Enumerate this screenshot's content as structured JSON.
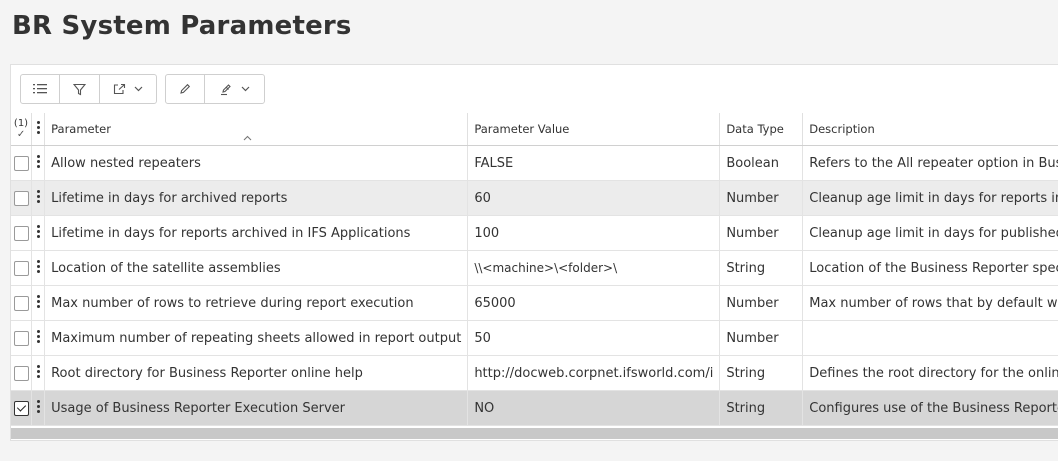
{
  "page": {
    "title": "BR System Parameters"
  },
  "toolbar": {
    "icons": [
      "column-list-icon",
      "filter-icon",
      "export-icon",
      "chevron-down-icon",
      "edit-pencil-icon",
      "bulk-edit-icon",
      "chevron-down-icon"
    ]
  },
  "table": {
    "selected_count": "(1)",
    "selected_count_mark": "✓",
    "columns": {
      "parameter": "Parameter",
      "value": "Parameter Value",
      "type": "Data Type",
      "description": "Description"
    },
    "sorted_column": "parameter",
    "sort_direction": "ascending",
    "rows": [
      {
        "parameter": "Allow nested repeaters",
        "value": "FALSE",
        "type": "Boolean",
        "description": "Refers to the All repeater option in Bus",
        "checked": false
      },
      {
        "parameter": "Lifetime in days for archived reports",
        "value": "60",
        "type": "Number",
        "description": "Cleanup age limit in days for reports in",
        "checked": false
      },
      {
        "parameter": "Lifetime in days for reports archived in IFS Applications",
        "value": "100",
        "type": "Number",
        "description": "Cleanup age limit in days for published",
        "checked": false
      },
      {
        "parameter": "Location of the satellite assemblies",
        "value": "\\\\<machine>\\<folder>\\",
        "type": "String",
        "description": "Location of the Business Reporter spec",
        "checked": false
      },
      {
        "parameter": "Max number of rows to retrieve during report execution",
        "value": "65000",
        "type": "Number",
        "description": "Max number of rows that by default wi",
        "checked": false
      },
      {
        "parameter": "Maximum number of repeating sheets allowed in report output",
        "value": "50",
        "type": "Number",
        "description": "",
        "checked": false
      },
      {
        "parameter": "Root directory for Business Reporter online help",
        "value": "http://docweb.corpnet.ifsworld.com/i",
        "type": "String",
        "description": "Defines the root directory for the onlin",
        "checked": false
      },
      {
        "parameter": "Usage of Business Reporter Execution Server",
        "value": "NO",
        "type": "String",
        "description": "Configures use of the Business Reporte",
        "checked": true
      }
    ]
  },
  "colors": {
    "selected_row": "#d6d6d6",
    "alt_row": "#ececec",
    "scrollbar": "#c8c8c8"
  }
}
